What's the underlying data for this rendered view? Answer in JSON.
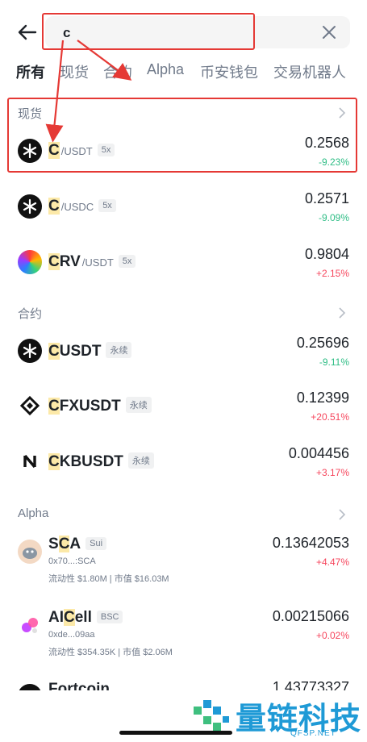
{
  "search": {
    "query": "c"
  },
  "tabs": [
    "所有",
    "现货",
    "合约",
    "Alpha",
    "币安钱包",
    "交易机器人"
  ],
  "sections": {
    "spot": {
      "title": "现货"
    },
    "futures": {
      "title": "合约"
    },
    "alpha": {
      "title": "Alpha"
    }
  },
  "spot_rows": [
    {
      "highlight": "C",
      "rest": "",
      "quote": "/USDT",
      "badge": "5x",
      "price": "0.2568",
      "change": "-9.23%",
      "icon": "c-coin-icon"
    },
    {
      "highlight": "C",
      "rest": "",
      "quote": "/USDC",
      "badge": "5x",
      "price": "0.2571",
      "change": "-9.09%",
      "icon": "c-coin-icon"
    },
    {
      "highlight": "C",
      "rest": "RV",
      "quote": "/USDT",
      "badge": "5x",
      "price": "0.9804",
      "change": "+2.15%",
      "icon": "crv-coin-icon"
    }
  ],
  "futures_rows": [
    {
      "highlight": "C",
      "rest": "USDT",
      "badge": "永续",
      "price": "0.25696",
      "change": "-9.11%",
      "icon": "c-coin-icon"
    },
    {
      "highlight": "C",
      "rest": "FXUSDT",
      "badge": "永续",
      "price": "0.12399",
      "change": "+20.51%",
      "icon": "cfx-coin-icon"
    },
    {
      "highlight": "C",
      "rest": "KBUSDT",
      "badge": "永续",
      "price": "0.004456",
      "change": "+3.17%",
      "icon": "ckb-coin-icon"
    }
  ],
  "alpha_rows": [
    {
      "pre": "S",
      "highlight": "C",
      "rest": "A",
      "badge": "Sui",
      "address": "0x70...:SCA",
      "liquidity": "流动性 $1.80M",
      "mcap": "市值 $16.03M",
      "price": "0.13642053",
      "change": "+4.47%",
      "icon": "sca-coin-icon"
    },
    {
      "pre": "AI",
      "highlight": "C",
      "rest": "ell",
      "badge": "BSC",
      "address": "0xde...09aa",
      "liquidity": "流动性 $354.35K",
      "mcap": "市值 $2.06M",
      "price": "0.00215066",
      "change": "+0.02%",
      "icon": "aicell-coin-icon"
    },
    {
      "pre": "Fortcoin",
      "highlight": "",
      "rest": "",
      "badge": "",
      "price": "1.43773327",
      "change": "",
      "icon": "fortcoin-coin-icon"
    }
  ],
  "watermark": {
    "brand": "量链科技",
    "domain": "QFSP.NET"
  },
  "colors": {
    "up": "#f6465d",
    "down": "#2ebd85",
    "highlight": "#fce9a8",
    "annotation": "#e53935"
  }
}
